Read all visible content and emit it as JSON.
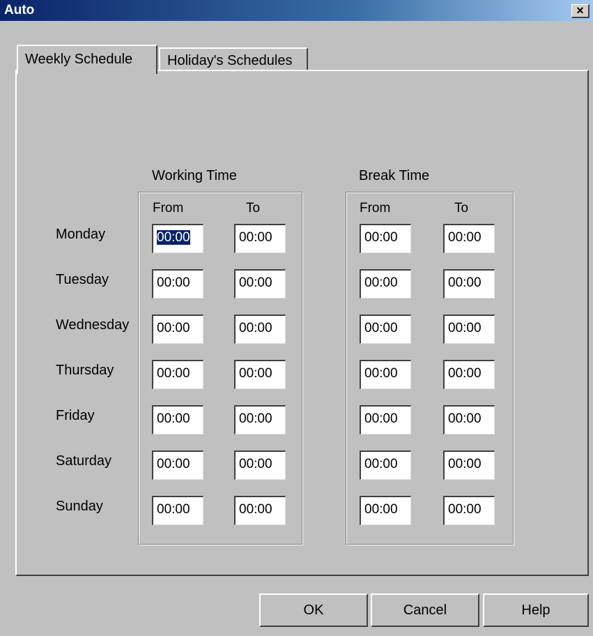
{
  "window": {
    "title": "Auto",
    "close_label": "×"
  },
  "tabs": [
    {
      "label": "Weekly Schedule",
      "active": true
    },
    {
      "label": "Holiday's Schedules",
      "active": false
    }
  ],
  "groups": {
    "working": {
      "label": "Working Time",
      "from_label": "From",
      "to_label": "To"
    },
    "break": {
      "label": "Break Time",
      "from_label": "From",
      "to_label": "To"
    }
  },
  "days": [
    {
      "name": "Monday",
      "work_from": "00:00",
      "work_to": "00:00",
      "break_from": "00:00",
      "break_to": "00:00"
    },
    {
      "name": "Tuesday",
      "work_from": "00:00",
      "work_to": "00:00",
      "break_from": "00:00",
      "break_to": "00:00"
    },
    {
      "name": "Wednesday",
      "work_from": "00:00",
      "work_to": "00:00",
      "break_from": "00:00",
      "break_to": "00:00"
    },
    {
      "name": "Thursday",
      "work_from": "00:00",
      "work_to": "00:00",
      "break_from": "00:00",
      "break_to": "00:00"
    },
    {
      "name": "Friday",
      "work_from": "00:00",
      "work_to": "00:00",
      "break_from": "00:00",
      "break_to": "00:00"
    },
    {
      "name": "Saturday",
      "work_from": "00:00",
      "work_to": "00:00",
      "break_from": "00:00",
      "break_to": "00:00"
    },
    {
      "name": "Sunday",
      "work_from": "00:00",
      "work_to": "00:00",
      "break_from": "00:00",
      "break_to": "00:00"
    }
  ],
  "buttons": {
    "ok": "OK",
    "cancel": "Cancel",
    "help": "Help"
  },
  "colors": {
    "title_bar": "#0a246a",
    "face": "#c0c0c0",
    "selection": "#0a246a"
  }
}
